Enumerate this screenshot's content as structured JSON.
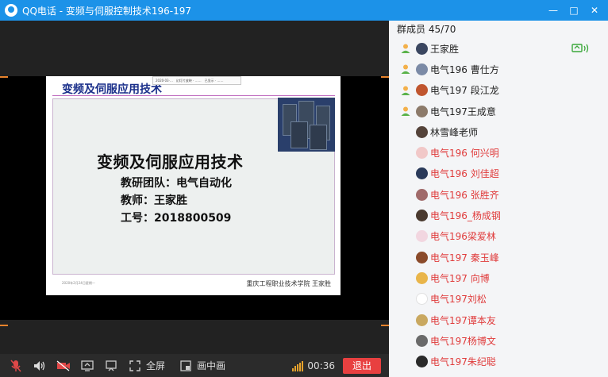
{
  "window": {
    "title": "QQ电话 - 变频与伺服控制技术196-197",
    "minimize": "—",
    "maximize": "□",
    "close": "✕"
  },
  "slide": {
    "header": "变频及伺服应用技术",
    "toolbar_items": [
      "2020·03·…",
      "幻灯片放映 · ……",
      "已显示 · ……"
    ],
    "main_title": "变频及伺服应用技术",
    "team": "教研团队：电气自动化",
    "teacher": "教师：王家胜",
    "staff_no": "工号：2018800509",
    "footer_left": "2020年2月24日星期一",
    "footer_right": "重庆工程职业技术学院  王家胜"
  },
  "controls": {
    "fullscreen_label": "全屏",
    "pip_label": "画中画",
    "time": "00:36",
    "exit_label": "退出",
    "signal_level": 5,
    "signal_max": 5
  },
  "members": {
    "header": "群成员 45/70",
    "list": [
      {
        "name": "王家胜",
        "color": "black",
        "host": true,
        "live": true,
        "avatar": "#3a4660"
      },
      {
        "name": "电气196 曹仕方",
        "color": "black",
        "host": true,
        "live": false,
        "avatar": "#7b8aa6"
      },
      {
        "name": "电气197 段江龙",
        "color": "black",
        "host": true,
        "live": false,
        "avatar": "#c0552e"
      },
      {
        "name": "电气197王成意",
        "color": "black",
        "host": true,
        "live": false,
        "avatar": "#8c7a6a"
      },
      {
        "name": "林雪峰老师",
        "color": "black",
        "host": false,
        "live": false,
        "avatar": "#54433a"
      },
      {
        "name": "电气196 何兴明",
        "color": "red",
        "host": false,
        "live": false,
        "avatar": "#f1c8c8"
      },
      {
        "name": "电气196 刘佳超",
        "color": "red",
        "host": false,
        "live": false,
        "avatar": "#2a3a5a"
      },
      {
        "name": "电气196 张胜齐",
        "color": "red",
        "host": false,
        "live": false,
        "avatar": "#a06a6a"
      },
      {
        "name": "电气196_杨成钢",
        "color": "red",
        "host": false,
        "live": false,
        "avatar": "#4a3a2f"
      },
      {
        "name": "电气196梁爱林",
        "color": "red",
        "host": false,
        "live": false,
        "avatar": "#f2d6e0"
      },
      {
        "name": "电气197 秦玉峰",
        "color": "red",
        "host": false,
        "live": false,
        "avatar": "#8a4a2a"
      },
      {
        "name": "电气197 向博",
        "color": "red",
        "host": false,
        "live": false,
        "avatar": "#e9b54a"
      },
      {
        "name": "电气197刘松",
        "color": "red",
        "host": false,
        "live": false,
        "avatar": "#ffffff"
      },
      {
        "name": "电气197谭本友",
        "color": "red",
        "host": false,
        "live": false,
        "avatar": "#c9a860"
      },
      {
        "name": "电气197杨博文",
        "color": "red",
        "host": false,
        "live": false,
        "avatar": "#6a6a6a"
      },
      {
        "name": "电气197朱纪聪",
        "color": "red",
        "host": false,
        "live": false,
        "avatar": "#2a2a2a"
      }
    ]
  },
  "colors": {
    "titlebar": "#1c92e8",
    "exit_button": "#e84040",
    "member_red": "#e03c3c",
    "accent_orange": "#e8832c"
  }
}
